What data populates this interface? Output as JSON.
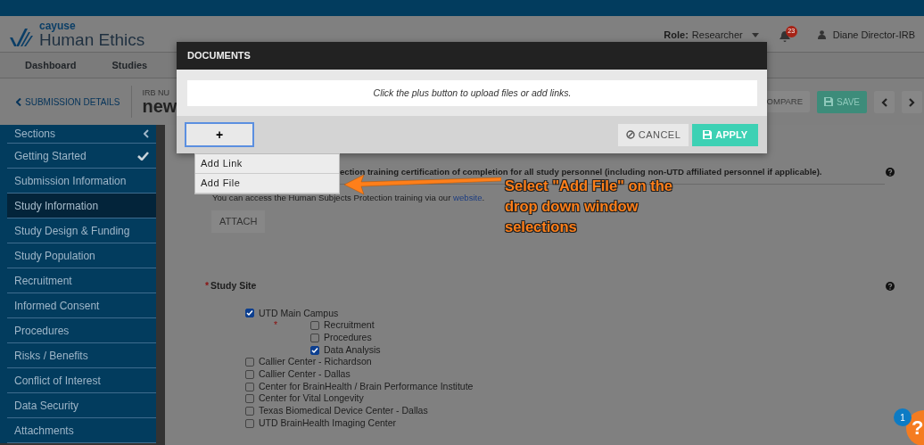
{
  "header": {
    "brand": "cayuse",
    "product": "Human Ethics",
    "role_label": "Role:",
    "role": "Researcher",
    "notifications": "23",
    "user": "Diane Director-IRB"
  },
  "nav": [
    "Dashboard",
    "Studies"
  ],
  "subheader": {
    "back": "SUBMISSION DETAILS",
    "irb_label": "IRB NU",
    "title": "new",
    "compare": "OMPARE",
    "save": "SAVE"
  },
  "sidebar": {
    "title": "Sections",
    "items": [
      {
        "label": "Getting Started",
        "selected": false,
        "completed": true
      },
      {
        "label": "Submission Information",
        "selected": false,
        "completed": false
      },
      {
        "label": "Study Information",
        "selected": true,
        "completed": false
      },
      {
        "label": "Study Design & Funding",
        "selected": false,
        "completed": false
      },
      {
        "label": "Study Population",
        "selected": false,
        "completed": false
      },
      {
        "label": "Recruitment",
        "selected": false,
        "completed": false
      },
      {
        "label": "Informed Consent",
        "selected": false,
        "completed": false
      },
      {
        "label": "Procedures",
        "selected": false,
        "completed": false
      },
      {
        "label": "Risks / Benefits",
        "selected": false,
        "completed": false
      },
      {
        "label": "Conflict of Interest",
        "selected": false,
        "completed": false
      },
      {
        "label": "Data Security",
        "selected": false,
        "completed": false
      },
      {
        "label": "Attachments",
        "selected": false,
        "completed": false
      }
    ]
  },
  "content": {
    "training_text": "ection training certification of completion for all study personnel (including non-UTD affiliated personnel if applicable).",
    "access_before": "You can access the Human Subjects Protection training via our ",
    "access_link": "website",
    "access_after": ".",
    "attach": "ATTACH",
    "study_site": {
      "label": "Study Site",
      "required_mark": "*",
      "options": [
        {
          "label": "UTD Main Campus",
          "checked": true,
          "required_mark": "*",
          "children": [
            {
              "label": "Recruitment",
              "checked": false
            },
            {
              "label": "Procedures",
              "checked": false
            },
            {
              "label": "Data Analysis",
              "checked": true
            }
          ]
        },
        {
          "label": "Callier Center - Richardson",
          "checked": false
        },
        {
          "label": "Callier Center - Dallas",
          "checked": false
        },
        {
          "label": "Center for BrainHealth / Brain Performance Institute",
          "checked": false
        },
        {
          "label": "Center for Vital Longevity",
          "checked": false
        },
        {
          "label": "Texas Biomedical Device Center - Dallas",
          "checked": false
        },
        {
          "label": "UTD BrainHealth Imaging Center",
          "checked": false
        }
      ]
    }
  },
  "modal": {
    "title": "DOCUMENTS",
    "hint": "Click the plus button to upload files or add links.",
    "add": "+",
    "cancel": "CANCEL",
    "apply": "APPLY",
    "menu": [
      "Add Link",
      "Add File"
    ]
  },
  "annotation": {
    "text": "Select \"Add File\" on the drop down window selections"
  },
  "help": {
    "label": "?",
    "badge": "1"
  }
}
